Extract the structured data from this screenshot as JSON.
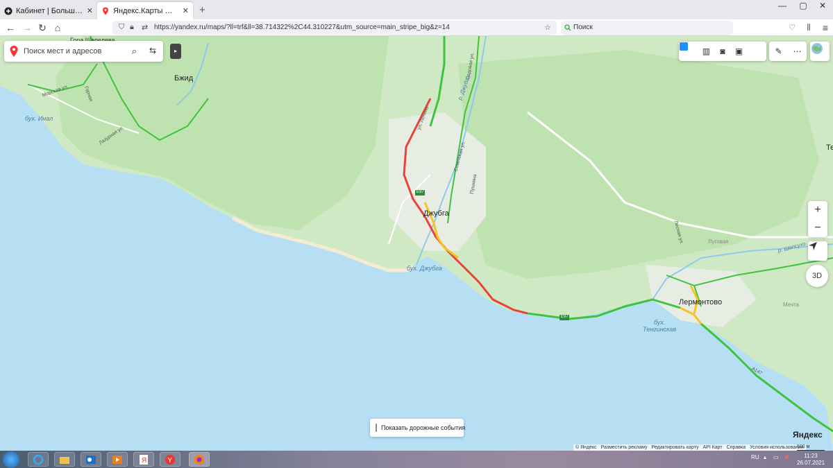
{
  "browser": {
    "tabs": [
      {
        "label": "Кабинет | Большие черномор...",
        "close": "✕"
      },
      {
        "label": "Яндекс.Карты — транспорт, н...",
        "close": "✕"
      }
    ],
    "new_tab": "+",
    "url": "https://yandex.ru/maps/?ll=trf&ll=38.714322%2C44.310227&utm_source=main_stripe_big&z=14",
    "search_placeholder": "Поиск"
  },
  "map": {
    "search_placeholder": "Поиск мест и адресов",
    "labels": {
      "gora_shepeleva": "Гора Шепелева",
      "bzhid": "Бжид",
      "bukh_inal": "бух. Инал",
      "dzhubga": "Джубга",
      "bukh_dzhubga": "бух. Джубга",
      "lermontovo": "Лермонтово",
      "bukh_tenginskaya": "бух.\nТенгинская",
      "e97_a": "E97",
      "e97_b": "E97",
      "morskaya": "Морская ул.",
      "lazurnaya": "Лазурная ул.",
      "gornaya": "Горная",
      "ul_lenina": "ул. Ленина",
      "r_shapsuho": "р. Шапсухо",
      "r_dzhubga": "р. Джубга",
      "sadovaya": "Садовая ул.",
      "sovetskaya": "Советская ул.",
      "pushkina": "Пушкина",
      "lesnaya": "Лесная ул.",
      "mechta": "Мечта",
      "lugovaya": "Луговая",
      "te": "Те",
      "a147": "А147"
    },
    "events_label": "Показать дорожные события",
    "logo": "Яндекс",
    "scale": "500 м",
    "footer": [
      "© Яндекс",
      "Разместить рекламу",
      "Редактировать карту",
      "API Карт",
      "Справка",
      "Условия использования"
    ],
    "zoom_in": "+",
    "zoom_out": "−",
    "btn_3d": "3D"
  },
  "taskbar": {
    "lang": "RU",
    "time": "11:23",
    "date": "26.07.2021"
  },
  "colors": {
    "sea": "#b6dff4",
    "land": "#cfe9c4",
    "forest": "#bfe3b0",
    "road_green": "#3ec33e",
    "road_red": "#e8423a",
    "road_yellow": "#f5c422",
    "accent_red": "#f33"
  }
}
